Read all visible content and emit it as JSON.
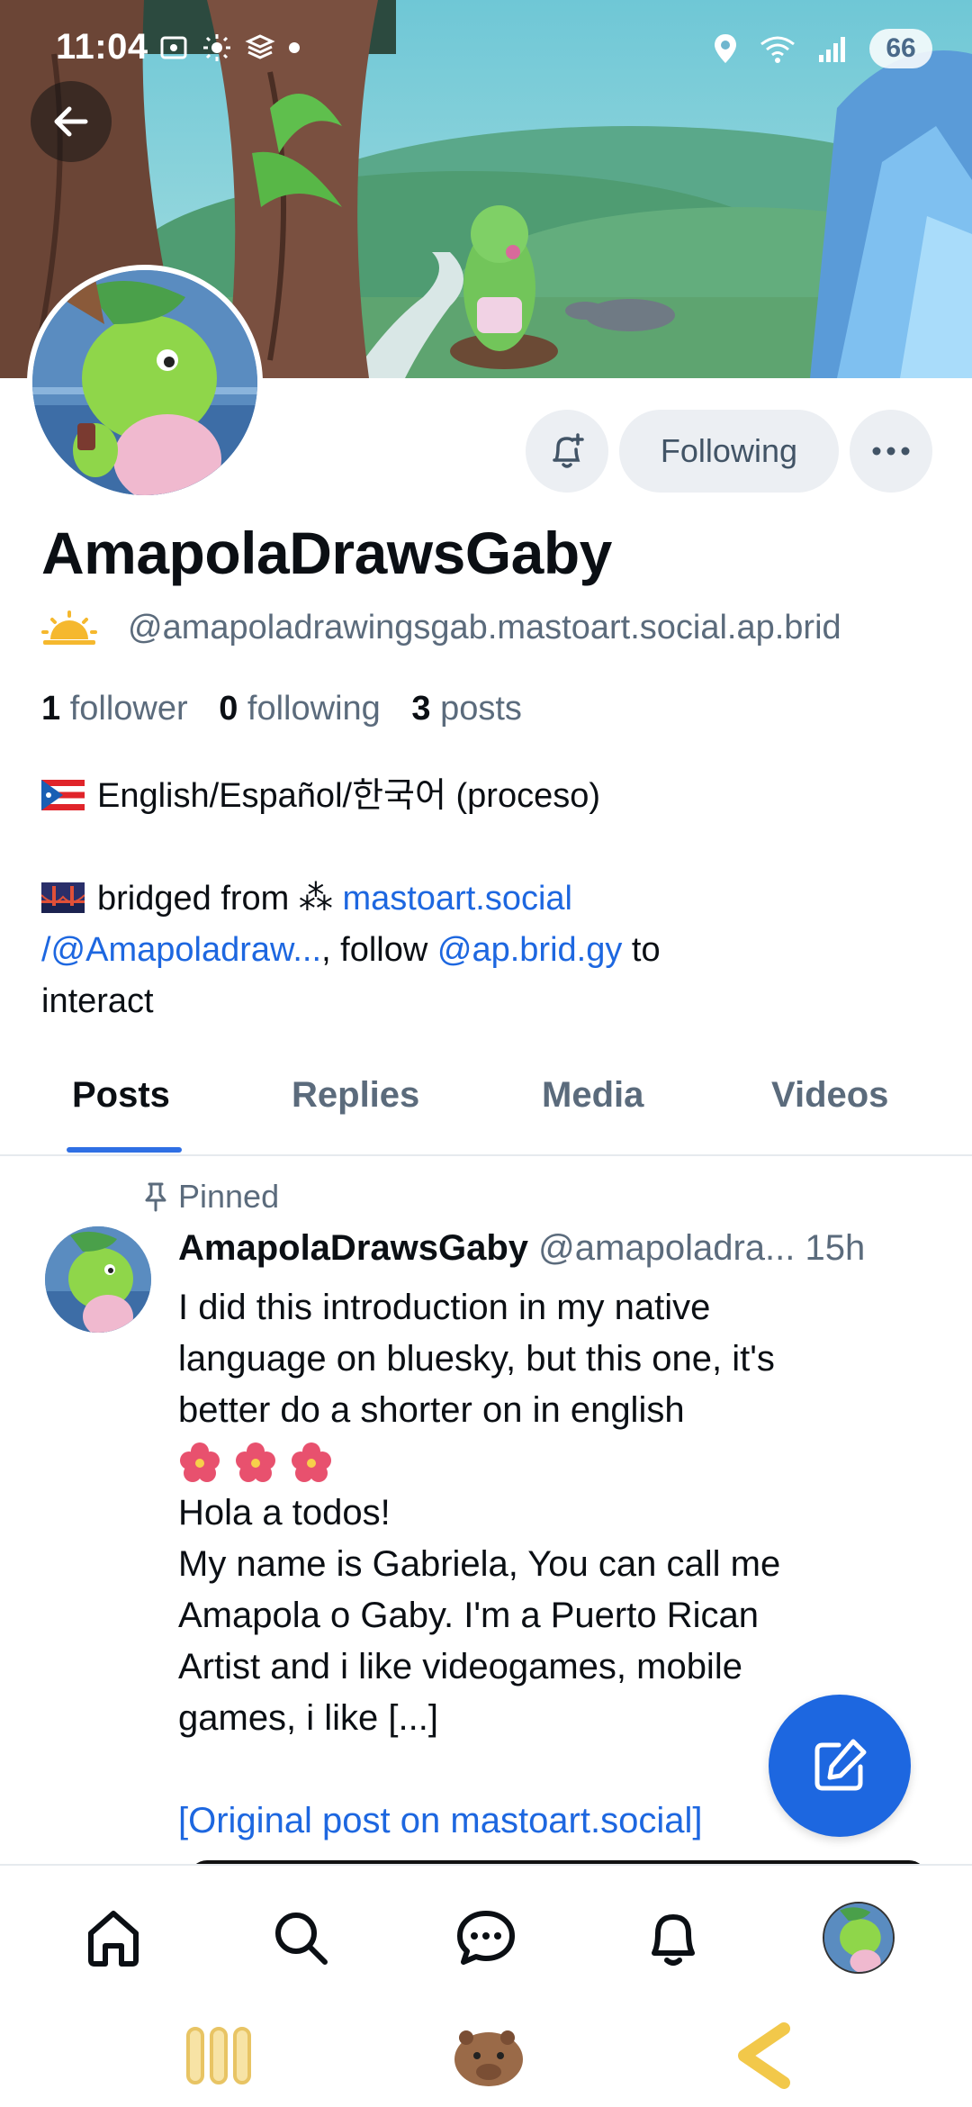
{
  "status_bar": {
    "time": "11:04",
    "battery": "66"
  },
  "profile": {
    "display_name": "AmapolaDrawsGaby",
    "handle": "@amapoladrawingsgab.mastoart.social.ap.brid",
    "following_label": "Following",
    "stats": {
      "followers_count": "1",
      "followers_label": "follower",
      "following_count": "0",
      "following_label": "following",
      "posts_count": "3",
      "posts_label": "posts"
    },
    "bio": {
      "languages": "English/Español/한국어 (proceso)",
      "bridged_prefix": "bridged from ⁂ ",
      "bridged_link_1": "mastoart.social",
      "bridged_link_2": "/@Amapoladraw...",
      "bridged_mid": ", follow ",
      "bridged_link_3": "@ap.brid.gy",
      "bridged_suffix": " to",
      "bridged_end": "interact"
    }
  },
  "tabs": [
    {
      "label": "Posts",
      "active": true
    },
    {
      "label": "Replies",
      "active": false
    },
    {
      "label": "Media",
      "active": false
    },
    {
      "label": "Videos",
      "active": false
    }
  ],
  "post": {
    "pinned_label": "Pinned",
    "author": "AmapolaDrawsGaby",
    "handle": "@amapoladra...",
    "time": "15h",
    "line1": "I did this introduction in my native",
    "line2": "language on bluesky, but this one, it's",
    "line3": "better do a shorter on in english",
    "line4": "Hola a todos!",
    "line5": "My name is Gabriela, You can call me",
    "line6": "Amapola o Gaby. I'm a Puerto Rican",
    "line7": "Artist and i like videogames, mobile",
    "line8": "games, i like [...]",
    "original_link": "[Original post on mastoart.social]"
  },
  "icons": {
    "back": "arrow-left-icon",
    "bell": "bell-plus-icon",
    "more": "ellipsis-icon",
    "compose": "compose-icon",
    "home": "home-icon",
    "search": "search-icon",
    "chat": "chat-icon",
    "notifications": "bell-icon"
  },
  "colors": {
    "accent": "#1d67e0",
    "muted": "#5b6b7c",
    "button_bg": "#eceff3"
  }
}
